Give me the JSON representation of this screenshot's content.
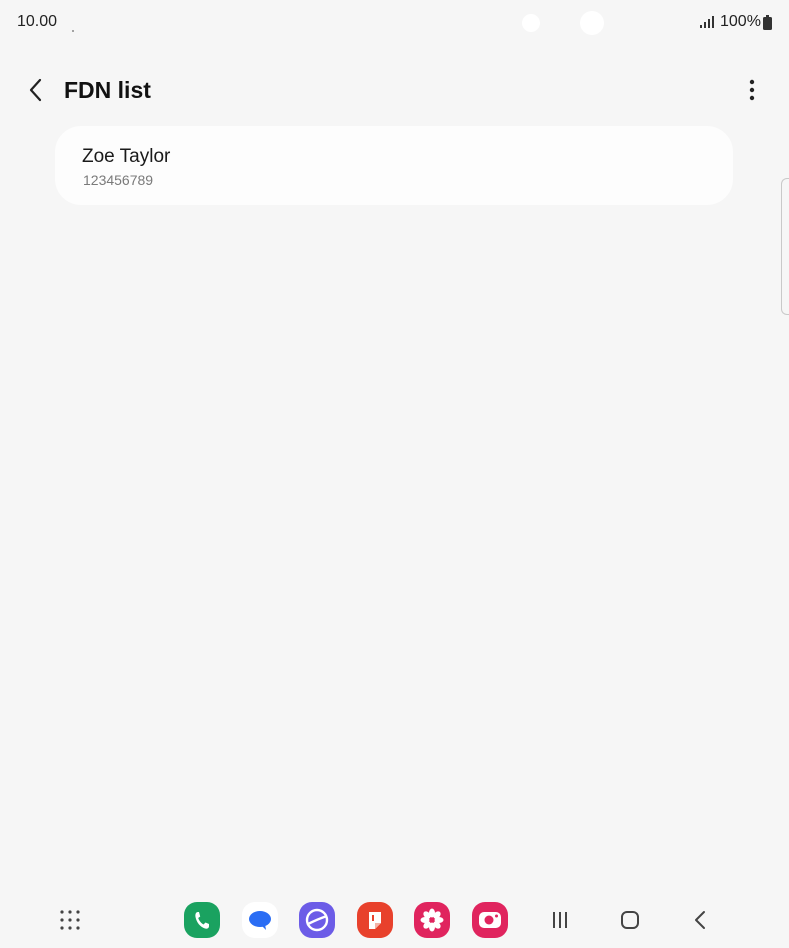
{
  "status_bar": {
    "time": "10.00",
    "battery": "100%"
  },
  "header": {
    "title": "FDN list",
    "back_icon": "chevron-left-icon",
    "more_icon": "more-vertical-icon"
  },
  "fdn_list": {
    "items": [
      {
        "name": "Zoe Taylor",
        "number": "123456789"
      }
    ]
  },
  "dock": {
    "apps": [
      {
        "name": "phone",
        "color": "#1aa260"
      },
      {
        "name": "messages",
        "color": "#2a6df4"
      },
      {
        "name": "internet",
        "color": "#6c5ce7"
      },
      {
        "name": "notes",
        "color": "#e8412c"
      },
      {
        "name": "bixby-blossom",
        "color": "#e0245e"
      },
      {
        "name": "camera",
        "color": "#e0245e"
      }
    ]
  },
  "navigation": {
    "recents_icon": "recents-icon",
    "home_icon": "home-icon",
    "back_icon": "back-icon",
    "apps_icon": "apps-grid-icon"
  }
}
